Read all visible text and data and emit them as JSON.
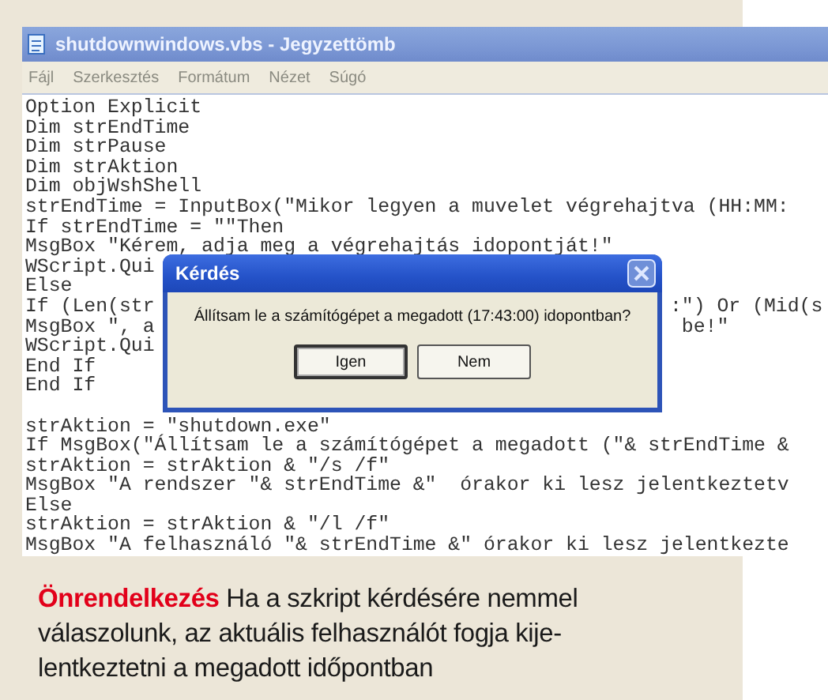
{
  "window": {
    "title": "shutdownwindows.vbs - Jegyzettömb"
  },
  "menu": [
    "Fájl",
    "Szerkesztés",
    "Formátum",
    "Nézet",
    "Súgó"
  ],
  "code_lines": [
    {
      "text": "Option Explicit"
    },
    {
      "text": "Dim strEndTime"
    },
    {
      "text": "Dim strPause"
    },
    {
      "text": "Dim strAktion"
    },
    {
      "text": "Dim objWshShell"
    },
    {
      "text": "strEndTime = InputBox(\"Mikor legyen a muvelet végrehajtva (HH:MM:"
    },
    {
      "text": "If strEndTime = \"\"Then"
    },
    {
      "text": "MsgBox \"Kérem, adja meg a végrehajtás idopontját!\""
    },
    {
      "text": "WScript.Qui"
    },
    {
      "text": "Else"
    },
    {
      "text": "If (Len(str",
      "after": ":\") Or (Mid(s"
    },
    {
      "text": "MsgBox \", a",
      "after": " be!\""
    },
    {
      "text": "WScript.Qui"
    },
    {
      "text": "End If"
    },
    {
      "text": "End If"
    },
    {
      "text": "strAktion = \"shutdown.exe\"",
      "gap_before": true
    },
    {
      "text": "If MsgBox(\"Állítsam le a számítógépet a megadott (\"& strEndTime &"
    },
    {
      "text": "strAktion = strAktion & \"/s /f\""
    },
    {
      "text": "MsgBox \"A rendszer \"& strEndTime &\"  órakor ki lesz jelentkeztetv"
    },
    {
      "text": "Else"
    },
    {
      "text": "strAktion = strAktion & \"/l /f\""
    },
    {
      "text": "MsgBox \"A felhasználó \"& strEndTime &\" órakor ki lesz jelentkezte"
    }
  ],
  "dialog": {
    "title": "Kérdés",
    "message": "Állítsam le a számítógépet a megadott (17:43:00) idopontban?",
    "buttons": [
      {
        "label": "Igen",
        "focused": true
      },
      {
        "label": "Nem",
        "focused": false
      }
    ]
  },
  "caption": {
    "lead": "Önrendelkezés",
    "text": "Ha a szkript kérdésére nemmel\nválaszolunk, az aktuális felhasználót fogja kije-\nlentkeztetni a megadott időpontban"
  }
}
